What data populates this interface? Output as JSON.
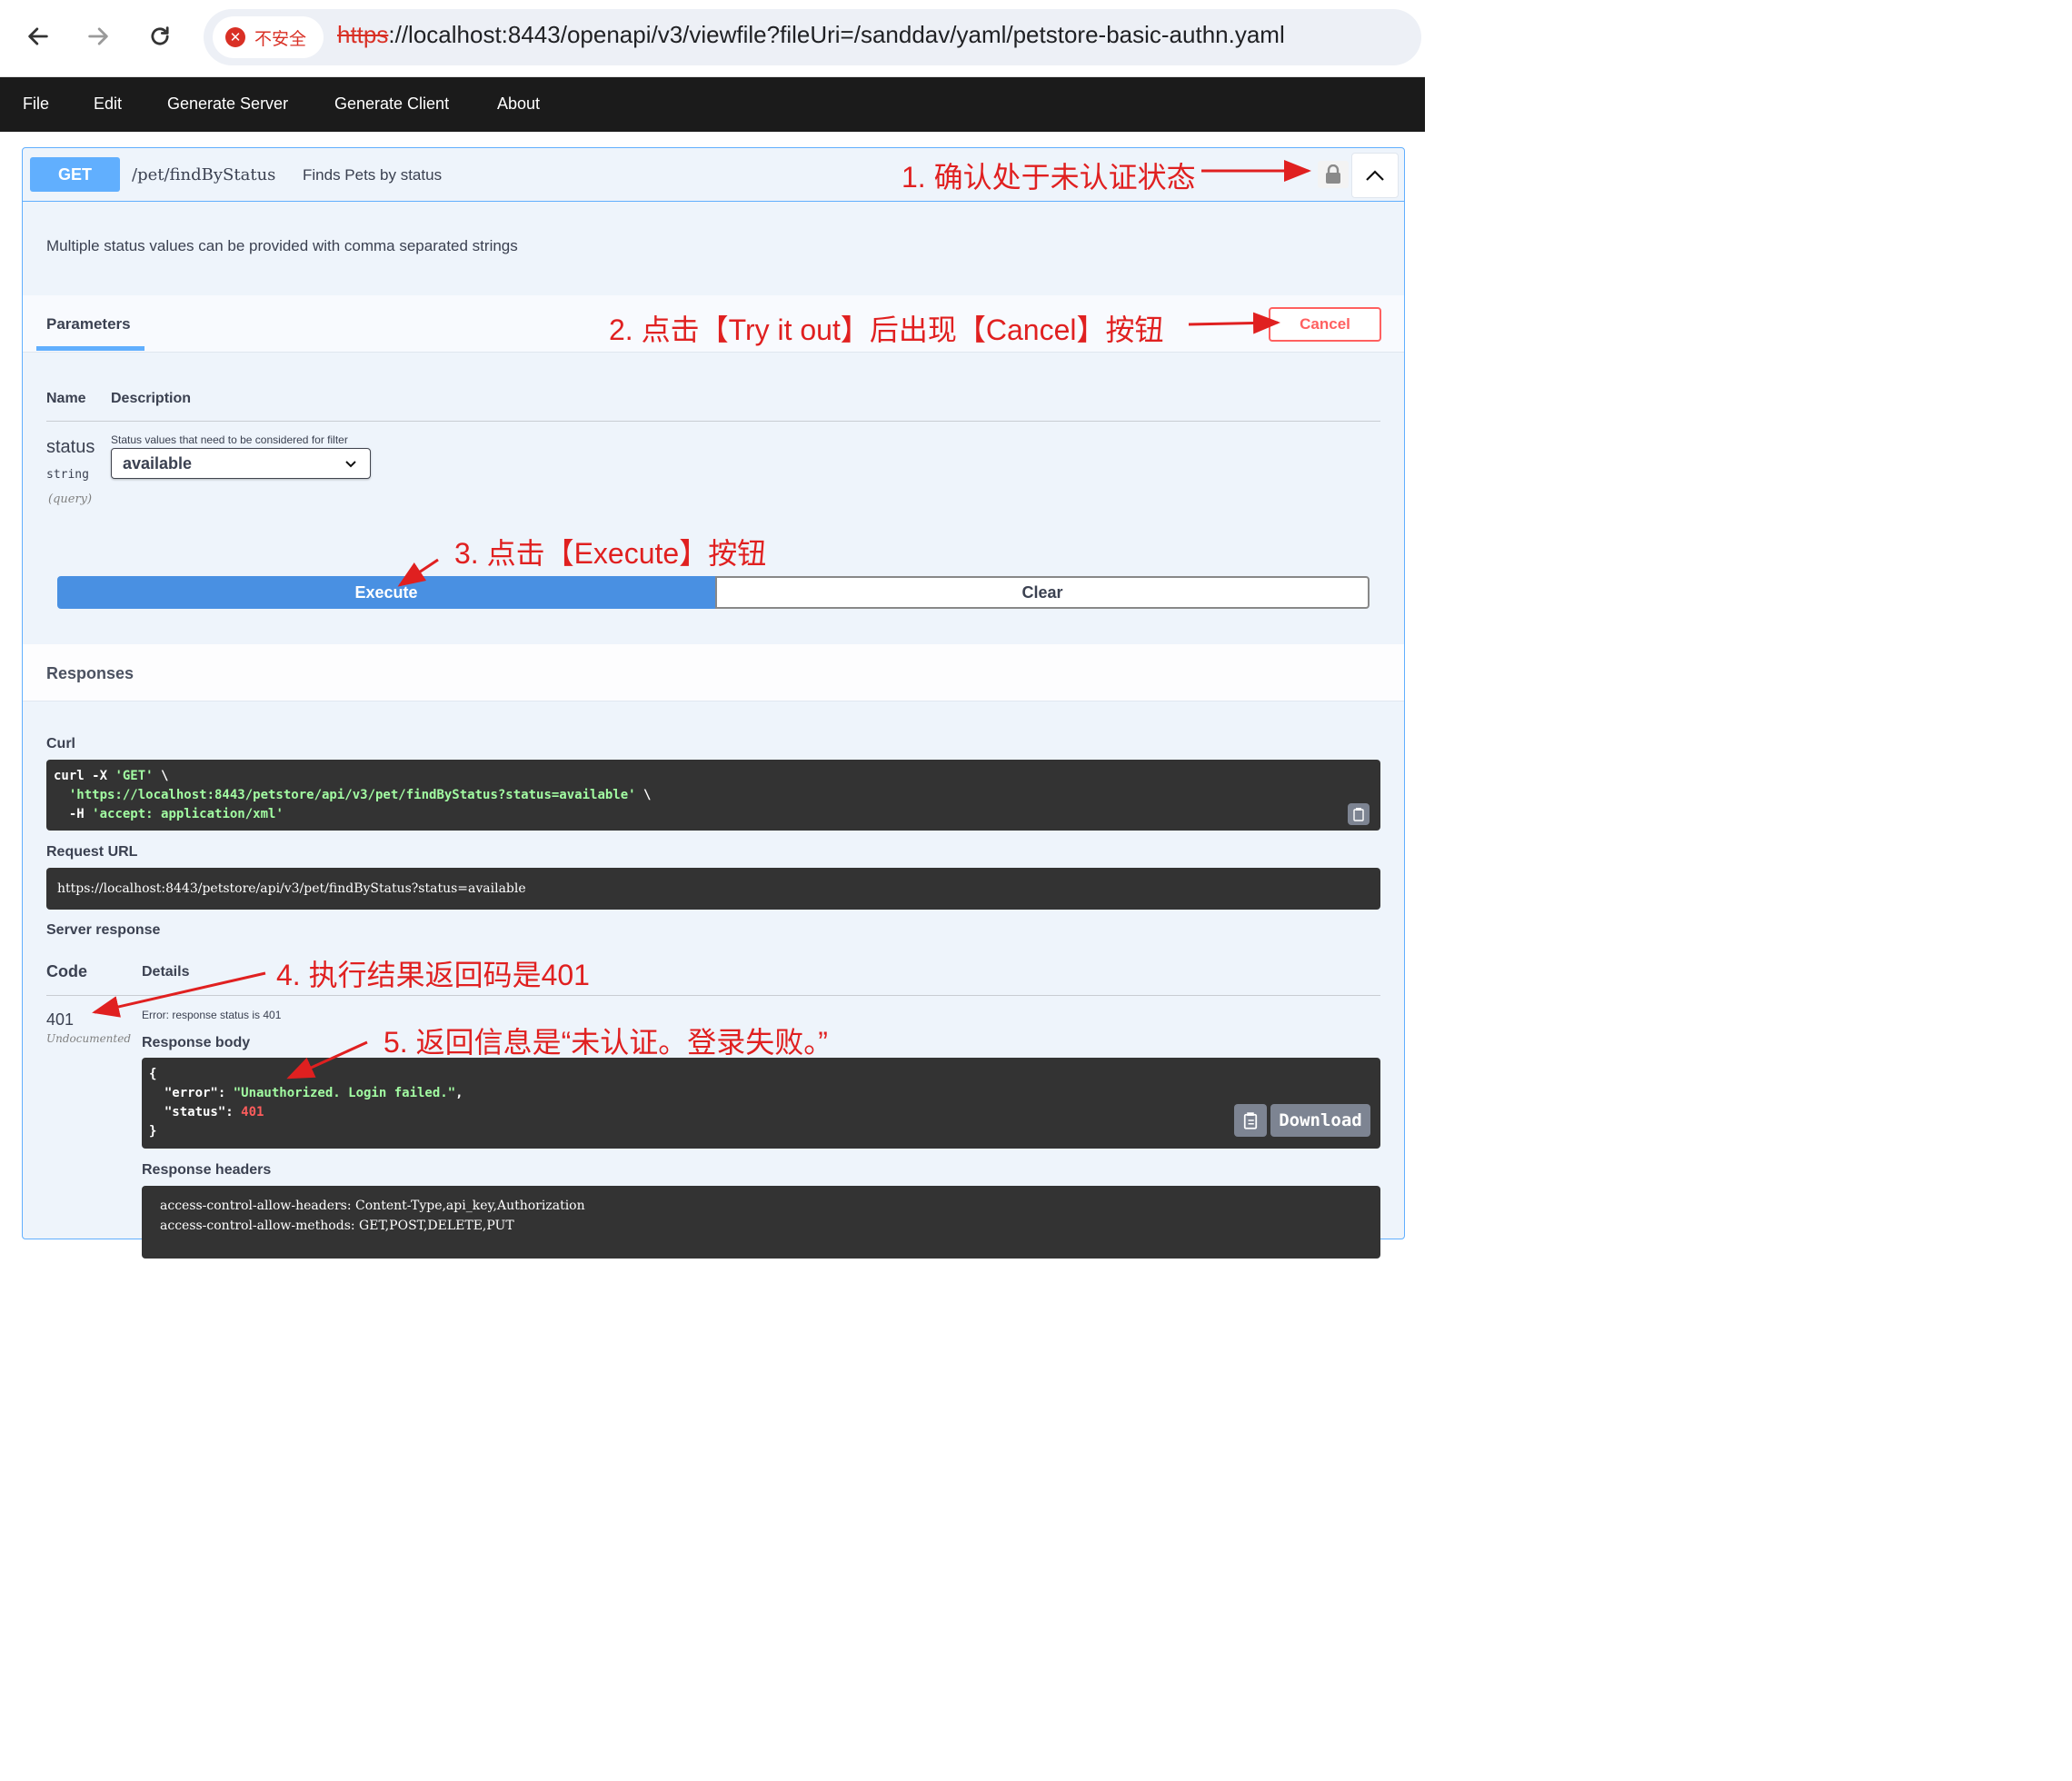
{
  "browser": {
    "security_label": "不安全",
    "url_scheme": "https",
    "url_rest": "://localhost:8443/openapi/v3/viewfile?fileUri=/sanddav/yaml/petstore-basic-authn.yaml"
  },
  "menu": {
    "items": [
      {
        "label": "File"
      },
      {
        "label": "Edit"
      },
      {
        "label": "Generate Server"
      },
      {
        "label": "Generate Client"
      },
      {
        "label": "About"
      }
    ]
  },
  "operation": {
    "method": "GET",
    "path": "/pet/findByStatus",
    "summary": "Finds Pets by status",
    "description": "Multiple status values can be provided with comma separated strings"
  },
  "parameters": {
    "tab_label": "Parameters",
    "cancel_label": "Cancel",
    "col_name": "Name",
    "col_description": "Description",
    "param": {
      "name": "status",
      "type": "string",
      "in": "(query)",
      "hint": "Status values that need to be considered for filter",
      "selected": "available"
    }
  },
  "actions": {
    "execute_label": "Execute",
    "clear_label": "Clear"
  },
  "responses": {
    "label": "Responses",
    "curl_label": "Curl",
    "curl_lines": [
      {
        "pre": "curl -X ",
        "str": "'GET'",
        "post": " \\"
      },
      {
        "pre": "  ",
        "str": "'https://localhost:8443/petstore/api/v3/pet/findByStatus?status=available'",
        "post": " \\"
      },
      {
        "pre": "  -H ",
        "str": "'accept: application/xml'",
        "post": ""
      }
    ],
    "request_url_label": "Request URL",
    "request_url": "https://localhost:8443/petstore/api/v3/pet/findByStatus?status=available",
    "server_response_label": "Server response",
    "code_header": "Code",
    "details_header": "Details",
    "code": "401",
    "code_note": "Undocumented",
    "error_text": "Error: response status is 401",
    "body_label": "Response body",
    "body_open": "{",
    "body_error_key": "  \"error\": ",
    "body_error_val": "\"Unauthorized. Login failed.\"",
    "body_error_end": ",",
    "body_status_key": "  \"status\": ",
    "body_status_val": "401",
    "body_close": "}",
    "download_label": "Download",
    "headers_label": "Response headers",
    "header_lines": [
      "access-control-allow-headers: Content-Type,api_key,Authorization",
      "access-control-allow-methods: GET,POST,DELETE,PUT"
    ]
  },
  "annotations": {
    "step1": "1. 确认处于未认证状态",
    "step2": "2. 点击【Try it out】后出现【Cancel】按钮",
    "step3": "3. 点击【Execute】按钮",
    "step4": "4. 执行结果返回码是401",
    "step5": "5. 返回信息是“未认证。登录失败。”"
  },
  "colors": {
    "get_blue": "#61affe",
    "execute_blue": "#4990e2",
    "cancel_red": "#ff6060",
    "annotation_red": "#e02020",
    "menu_bg": "#1b1b1b",
    "code_bg": "#333333"
  },
  "icons": [
    "back-arrow-icon",
    "forward-arrow-icon",
    "reload-icon",
    "insecure-x-icon",
    "lock-icon",
    "chevron-up-icon",
    "chevron-down-icon",
    "copy-icon"
  ]
}
